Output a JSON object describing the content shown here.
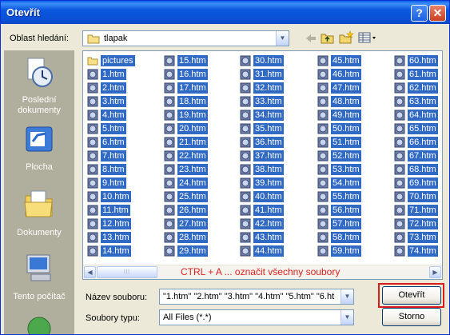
{
  "window": {
    "title": "Otevřít",
    "help_glyph": "?",
    "close_glyph": "✕"
  },
  "look_in": {
    "label": "Oblast hledání:",
    "value": "tlapak"
  },
  "places": [
    {
      "label": "Poslední dokumenty",
      "icon": "recent-documents-icon"
    },
    {
      "label": "Plocha",
      "icon": "desktop-icon"
    },
    {
      "label": "Dokumenty",
      "icon": "my-documents-icon"
    },
    {
      "label": "Tento počítač",
      "icon": "my-computer-icon"
    },
    {
      "label": "",
      "icon": "network-places-icon"
    }
  ],
  "files": {
    "columns": [
      [
        "pictures",
        "1.htm",
        "2.htm",
        "3.htm",
        "4.htm",
        "5.htm",
        "6.htm",
        "7.htm",
        "8.htm",
        "9.htm",
        "10.htm",
        "11.htm",
        "12.htm",
        "13.htm",
        "14.htm"
      ],
      [
        "15.htm",
        "16.htm",
        "17.htm",
        "18.htm",
        "19.htm",
        "20.htm",
        "21.htm",
        "22.htm",
        "23.htm",
        "24.htm",
        "25.htm",
        "26.htm",
        "27.htm",
        "28.htm",
        "29.htm"
      ],
      [
        "30.htm",
        "31.htm",
        "32.htm",
        "33.htm",
        "34.htm",
        "35.htm",
        "36.htm",
        "37.htm",
        "38.htm",
        "39.htm",
        "40.htm",
        "41.htm",
        "42.htm",
        "43.htm",
        "44.htm"
      ],
      [
        "45.htm",
        "46.htm",
        "47.htm",
        "48.htm",
        "49.htm",
        "50.htm",
        "51.htm",
        "52.htm",
        "53.htm",
        "54.htm",
        "55.htm",
        "56.htm",
        "57.htm",
        "58.htm",
        "59.htm"
      ],
      [
        "60.htm",
        "61.htm",
        "62.htm",
        "63.htm",
        "64.htm",
        "65.htm",
        "66.htm",
        "67.htm",
        "68.htm",
        "69.htm",
        "70.htm",
        "71.htm",
        "72.htm",
        "73.htm",
        "74.htm"
      ]
    ]
  },
  "annotation": "CTRL + A ... označit všechny soubory",
  "filename": {
    "label": "Název souboru:",
    "value": "\"1.htm\" \"2.htm\" \"3.htm\" \"4.htm\" \"5.htm\" \"6.ht"
  },
  "filetype": {
    "label": "Soubory typu:",
    "value": "All Files (*.*)"
  },
  "buttons": {
    "open": "Otevřít",
    "cancel": "Storno"
  },
  "colors": {
    "selection": "#316AC5",
    "titlebar": "#0A57DE",
    "highlight_box": "#D71C1C",
    "annotation": "#E02020"
  }
}
